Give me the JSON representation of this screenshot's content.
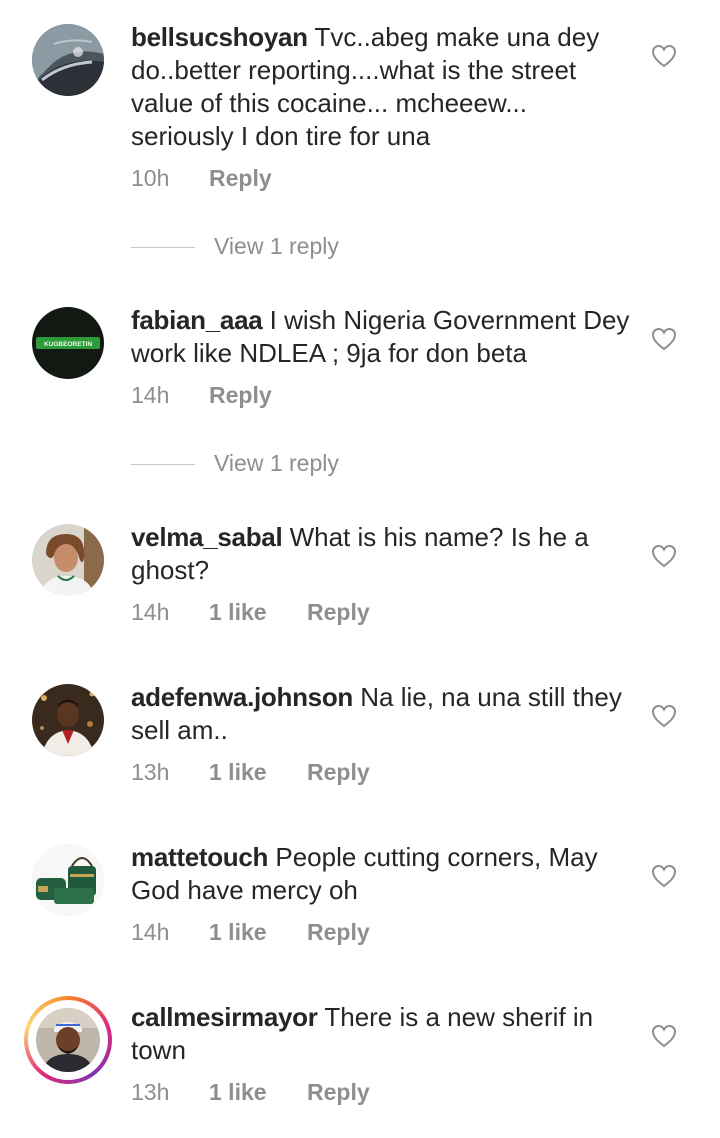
{
  "comments": [
    {
      "username": "bellsucshoyan",
      "text": " Tvc..abeg make una dey do..better reporting....what is the street value of this cocaine... mcheeew... seriously I don tire for una",
      "time": "10h",
      "likes": "",
      "reply_label": "Reply",
      "view_replies": "View 1 reply",
      "avatar_icon": "beach-shoreline-avatar"
    },
    {
      "username": "fabian_aaa",
      "text": " I wish Nigeria Government Dey work like NDLEA ; 9ja for don beta",
      "time": "14h",
      "likes": "",
      "reply_label": "Reply",
      "view_replies": "View 1 reply",
      "avatar_icon": "green-banner-avatar",
      "avatar_text": "KUGBEORETIN"
    },
    {
      "username": "velma_sabal",
      "text": " What is his name? Is he a ghost?",
      "time": "14h",
      "likes": "1 like",
      "reply_label": "Reply",
      "avatar_icon": "woman-portrait-avatar"
    },
    {
      "username": "adefenwa.johnson",
      "text": " Na lie, na una still they sell am..",
      "time": "13h",
      "likes": "1 like",
      "reply_label": "Reply",
      "avatar_icon": "man-portrait-avatar"
    },
    {
      "username": "mattetouch",
      "text": " People cutting corners, May God have mercy oh",
      "time": "14h",
      "likes": "1 like",
      "reply_label": "Reply",
      "avatar_icon": "handbags-avatar"
    },
    {
      "username": "callmesirmayor",
      "text": " There is a new sherif in town",
      "time": "13h",
      "likes": "1 like",
      "reply_label": "Reply",
      "avatar_icon": "man-cap-avatar-with-story-ring"
    }
  ],
  "colors": {
    "text": "#262626",
    "secondary": "#8e8e8e",
    "divider": "#c7c7c7",
    "story_ring": [
      "#f58529",
      "#dd2a7b",
      "#8134af"
    ]
  }
}
